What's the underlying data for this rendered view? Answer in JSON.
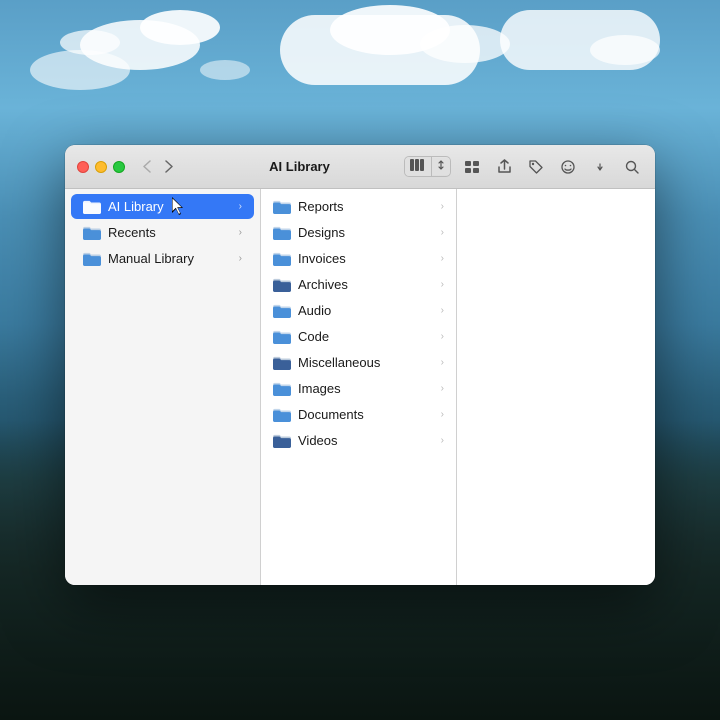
{
  "desktop": {
    "bg_description": "ocean waves with clouds"
  },
  "window": {
    "title": "AI Library",
    "traffic_lights": {
      "red_label": "close",
      "yellow_label": "minimize",
      "green_label": "maximize"
    },
    "toolbar": {
      "back_btn": "‹",
      "forward_btn": "›",
      "view_grid_label": "⊞",
      "view_toggle_label": "⊟",
      "share_label": "↑",
      "tag_label": "◇",
      "emoji_label": "☺",
      "search_label": "⌕"
    }
  },
  "sidebar": {
    "items": [
      {
        "id": "ai-library",
        "label": "AI Library",
        "active": true,
        "has_chevron": true,
        "icon_color": "blue"
      },
      {
        "id": "recents",
        "label": "Recents",
        "active": false,
        "has_chevron": true,
        "icon_color": "blue"
      },
      {
        "id": "manual-library",
        "label": "Manual Library",
        "active": false,
        "has_chevron": true,
        "icon_color": "blue"
      }
    ]
  },
  "middle_column": {
    "items": [
      {
        "id": "reports",
        "label": "Reports",
        "icon_color": "blue"
      },
      {
        "id": "designs",
        "label": "Designs",
        "icon_color": "blue"
      },
      {
        "id": "invoices",
        "label": "Invoices",
        "icon_color": "blue"
      },
      {
        "id": "archives",
        "label": "Archives",
        "icon_color": "dark"
      },
      {
        "id": "audio",
        "label": "Audio",
        "icon_color": "blue"
      },
      {
        "id": "code",
        "label": "Code",
        "icon_color": "blue"
      },
      {
        "id": "miscellaneous",
        "label": "Miscellaneous",
        "icon_color": "dark"
      },
      {
        "id": "images",
        "label": "Images",
        "icon_color": "blue"
      },
      {
        "id": "documents",
        "label": "Documents",
        "icon_color": "blue"
      },
      {
        "id": "videos",
        "label": "Videos",
        "icon_color": "dark"
      }
    ]
  }
}
